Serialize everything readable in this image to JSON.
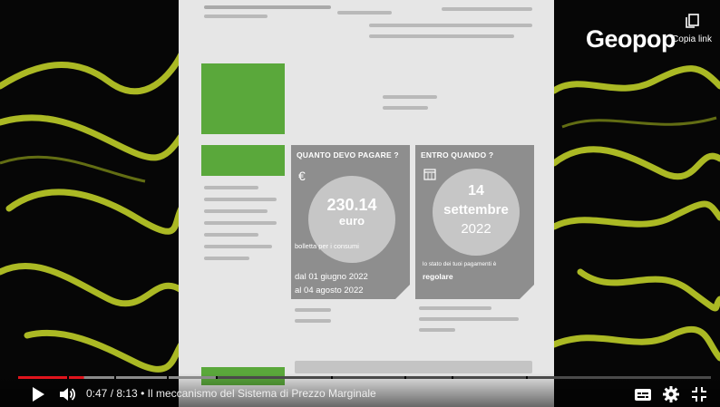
{
  "player": {
    "copy_link_label": "Copia link",
    "logo_text": "Geopop",
    "time_current": "0:47",
    "time_separator": " / ",
    "time_total": "8:13",
    "chapter_separator": " • ",
    "chapter_title": "Il meccanismo del Sistema di Prezzo Marginale",
    "progress_fraction": 0.095,
    "icons": [
      "copy-icon",
      "play-icon",
      "volume-icon",
      "subtitles-icon",
      "settings-icon",
      "exit-fullscreen-icon"
    ]
  },
  "bill": {
    "card_amount": {
      "heading": "QUANTO DEVO PAGARE ?",
      "currency_symbol": "€",
      "amount": "230.14",
      "unit": "euro",
      "caption": "bolletta per i consumi",
      "period_from": "dal 01 giugno 2022",
      "period_to": "al 04 agosto 2022"
    },
    "card_due": {
      "heading": "ENTRO QUANDO ?",
      "day": "14",
      "month": "settembre",
      "year": "2022",
      "status_caption": "lo stato dei tuoi pagamenti è",
      "status_value": "regolare"
    }
  },
  "colors": {
    "progress_played": "#e0141c",
    "progress_loaded": "#8a8a8a",
    "progress_rest": "#4a4a4a",
    "accent_green": "#5aa83b",
    "art_yellow": "#c8d92a"
  }
}
